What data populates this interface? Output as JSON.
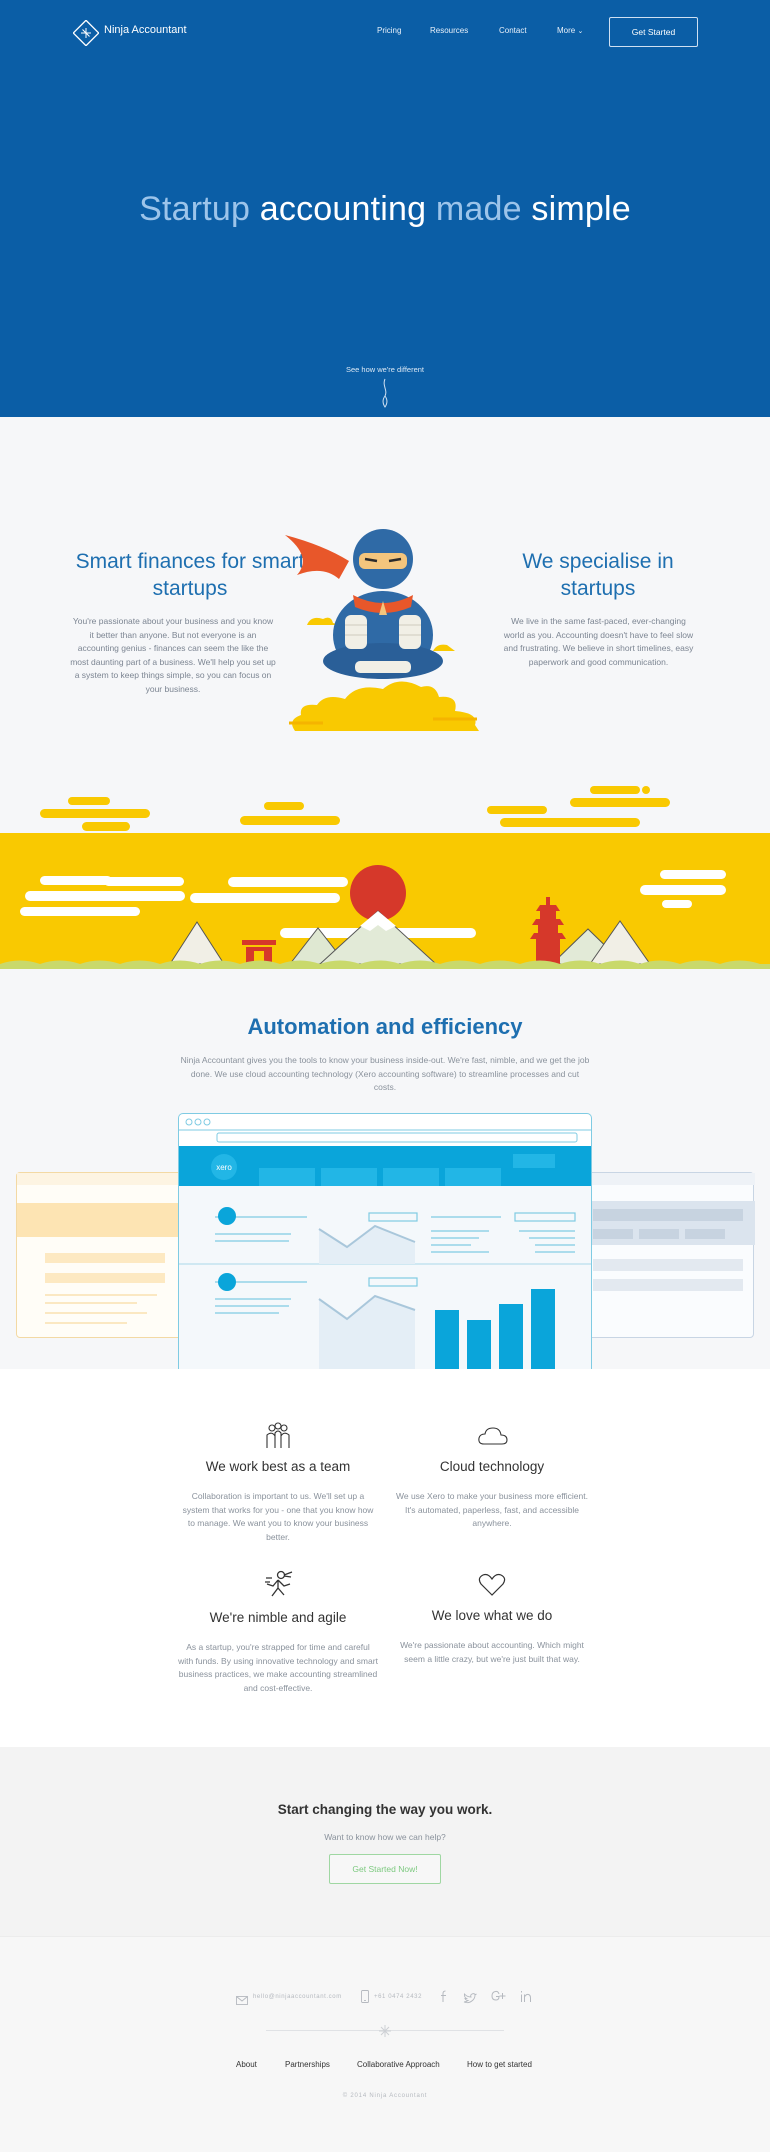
{
  "header": {
    "logo_text": "Ninja Accountant",
    "nav": [
      "Pricing",
      "Resources",
      "Contact",
      "More"
    ],
    "cta_label": "Get Started"
  },
  "hero": {
    "title_parts": [
      "Startup ",
      "accounting",
      " made ",
      "simple"
    ],
    "scroll_hint": "See how we're different"
  },
  "intro": {
    "left_title": "Smart finances for smart startups",
    "left_text": "You're passionate about your business and you know it better than anyone. But not everyone is an accounting genius - finances can seem the like the most daunting part of a business. We'll help you set up a system to keep things simple, so you can focus on your business.",
    "right_title": "We specialise in startups",
    "right_text": "We live in the same fast-paced, ever-changing world as you. Accounting doesn't have to feel slow and frustrating. We believe in short timelines, easy paperwork and good communication."
  },
  "automation": {
    "title": "Automation and efficiency",
    "text": "Ninja Accountant gives you the tools to know your business inside-out. We're fast, nimble, and we get the job done. We use cloud accounting technology (Xero accounting software) to streamline processes and cut costs.",
    "xero_label": "xero"
  },
  "features": [
    {
      "icon": "team-icon",
      "title": "We work best as a team",
      "text": "Collaboration is important to us. We'll set up a system that works for you - one that you know how to manage. We want you to know your business better."
    },
    {
      "icon": "cloud-icon",
      "title": "Cloud technology",
      "text": "We use Xero to make your business more efficient. It's automated, paperless, fast, and accessible anywhere."
    },
    {
      "icon": "ninja-runner-icon",
      "title": "We're nimble and agile",
      "text": "As a startup, you're strapped for time and careful with funds. By using innovative technology and smart business practices, we make accounting streamlined and cost-effective."
    },
    {
      "icon": "heart-icon",
      "title": "We love what we do",
      "text": "We're passionate about accounting. Which might seem a little crazy, but we're just built that way."
    }
  ],
  "cta": {
    "title": "Start changing the way you work.",
    "subtitle": "Want to know how we can help?",
    "button": "Get Started Now!"
  },
  "footer": {
    "email": "hello@ninjaaccountant.com",
    "phone": "+61 0474 2432",
    "social": [
      "facebook-icon",
      "twitter-icon",
      "googleplus-icon",
      "linkedin-icon"
    ],
    "links": [
      "About",
      "Partnerships",
      "Collaborative Approach",
      "How to get started"
    ],
    "copyright": "© 2014 Ninja Accountant"
  },
  "colors": {
    "hero_blue": "#0b5ea6",
    "heading_blue": "#1e6fb0",
    "band_yellow": "#f9c901",
    "xero_blue": "#0aa5da",
    "cta_green": "#7cc97f"
  }
}
